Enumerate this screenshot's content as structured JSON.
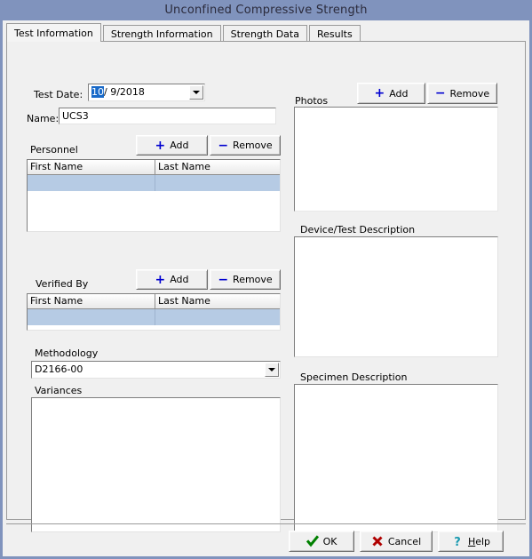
{
  "window": {
    "title": "Unconfined Compressive Strength",
    "titlebar_color": "#8093bd",
    "face_color": "#f0f0f0",
    "selection_color": "#b6cbe4",
    "accent_color": "#0000d0"
  },
  "tabs": [
    {
      "label": "Test Information",
      "active": true
    },
    {
      "label": "Strength Information",
      "active": false
    },
    {
      "label": "Strength Data",
      "active": false
    },
    {
      "label": "Results",
      "active": false
    }
  ],
  "test_information": {
    "test_date": {
      "label": "Test Date:",
      "selected_part": "10",
      "rest": "/  9/2018",
      "full_value": "10/ 9/2018"
    },
    "name": {
      "label": "Name:",
      "value": "UCS3",
      "placeholder": ""
    },
    "personnel": {
      "label": "Personnel",
      "add_label": "Add",
      "remove_label": "Remove",
      "columns": [
        "First Name",
        "Last Name"
      ],
      "rows": [
        {
          "first_name": "",
          "last_name": "",
          "selected": true
        }
      ]
    },
    "verified_by": {
      "label": "Verified By",
      "add_label": "Add",
      "remove_label": "Remove",
      "columns": [
        "First Name",
        "Last Name"
      ],
      "rows": [
        {
          "first_name": "",
          "last_name": "",
          "selected": true
        }
      ]
    },
    "methodology": {
      "label": "Methodology",
      "value": "D2166-00",
      "options": [
        "D2166-00"
      ]
    },
    "variances": {
      "label": "Variances",
      "value": "",
      "placeholder": ""
    },
    "photos": {
      "label": "Photos",
      "add_label": "Add",
      "remove_label": "Remove",
      "items": []
    },
    "device_test_description": {
      "label": "Device/Test Description",
      "value": "",
      "placeholder": ""
    },
    "specimen_description": {
      "label": "Specimen Description",
      "value": "",
      "placeholder": ""
    }
  },
  "footer": {
    "ok_label": "OK",
    "cancel_label": "Cancel",
    "help_label_prefix": "H",
    "help_label_rest": "elp",
    "ok_icon": "check-icon",
    "cancel_icon": "x-icon",
    "help_icon": "question-mark-icon"
  }
}
